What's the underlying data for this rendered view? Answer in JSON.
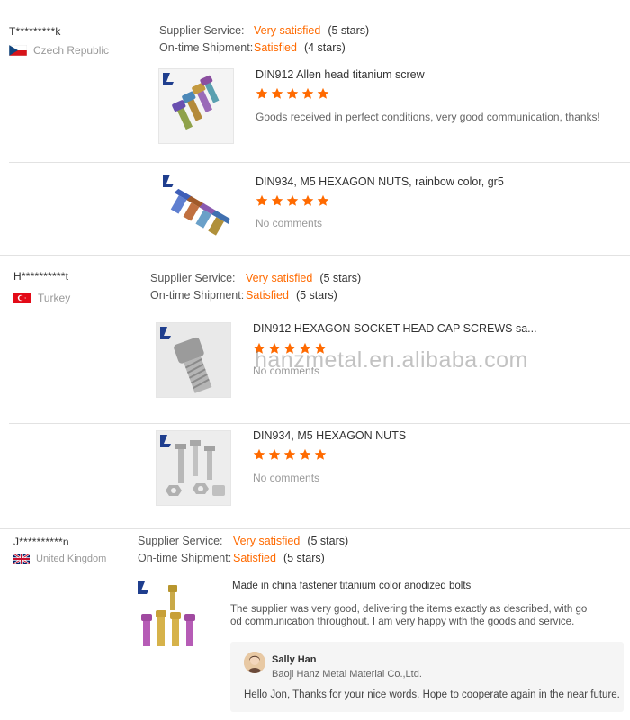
{
  "labels": {
    "supplier_service": "Supplier Service:",
    "ontime_shipment": "On-time Shipment:"
  },
  "reviews": [
    {
      "buyer": "T*********k",
      "country": "Czech Republic",
      "flag": "czech-flag",
      "supplier_service": "Very satisfied",
      "supplier_service_stars": "(5 stars)",
      "ontime_shipment": "Satisfied",
      "ontime_shipment_stars": "(4 stars)",
      "products": [
        {
          "title": "DIN912 Allen head titanium screw",
          "rating": 5,
          "comment": "Goods received in perfect conditions, very good communication, thanks!"
        },
        {
          "title": "DIN934, M5 HEXAGON NUTS, rainbow color, gr5",
          "rating": 5,
          "comment": "No comments"
        }
      ]
    },
    {
      "buyer": "H**********t",
      "country": "Turkey",
      "flag": "turkey-flag",
      "supplier_service": "Very satisfied",
      "supplier_service_stars": "(5 stars)",
      "ontime_shipment": "Satisfied",
      "ontime_shipment_stars": "(5 stars)",
      "products": [
        {
          "title": "DIN912 HEXAGON SOCKET HEAD CAP SCREWS sa...",
          "rating": 5,
          "comment": "No comments"
        },
        {
          "title": "DIN934, M5 HEXAGON NUTS",
          "rating": 5,
          "comment": "No comments"
        }
      ]
    },
    {
      "buyer": "J**********n",
      "country": "United Kingdom",
      "flag": "uk-flag",
      "supplier_service": "Very satisfied",
      "supplier_service_stars": "(5 stars)",
      "ontime_shipment": "Satisfied",
      "ontime_shipment_stars": "(5 stars)",
      "products": [
        {
          "title": "Made in china fastener titanium color anodized bolts",
          "comment_line1": "The supplier was very good, delivering the items exactly as described, with go",
          "comment_line2": "od communication throughout. I am very happy with the goods and service."
        }
      ],
      "reply": {
        "name": "Sally Han",
        "company": "Baoji Hanz Metal Material Co.,Ltd.",
        "text": "Hello Jon, Thanks for your nice words. Hope to cooperate again in the near future."
      }
    }
  ],
  "watermark": "hanzmetal.en.alibaba.com",
  "colors": {
    "accent": "#ff6a00",
    "star": "#ff6a00",
    "divider": "#e2e2e2"
  }
}
